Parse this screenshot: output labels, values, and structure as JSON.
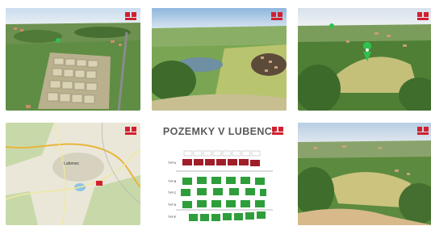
{
  "gallery": {
    "watermark_icon": "remax-balloon-icon",
    "tiles": [
      {
        "kind": "aerial-photo",
        "subject": "subdivision plots aerial"
      },
      {
        "kind": "aerial-photo",
        "subject": "pond and fields"
      },
      {
        "kind": "aerial-photo",
        "subject": "green meadow with pin"
      },
      {
        "kind": "map",
        "subject": "location map",
        "town_label": "Lubenec"
      },
      {
        "kind": "plan",
        "title": "POZEMKY V LUBENCI",
        "row_labels": [
          "TYP A",
          "TYP B",
          "TYP C",
          "TYP D",
          "TYP E"
        ]
      },
      {
        "kind": "aerial-photo",
        "subject": "hillside fields and village"
      }
    ]
  },
  "colors": {
    "brand_red": "#d2202f",
    "plot_green": "#2e9e3a",
    "plot_red": "#a01e2a"
  }
}
